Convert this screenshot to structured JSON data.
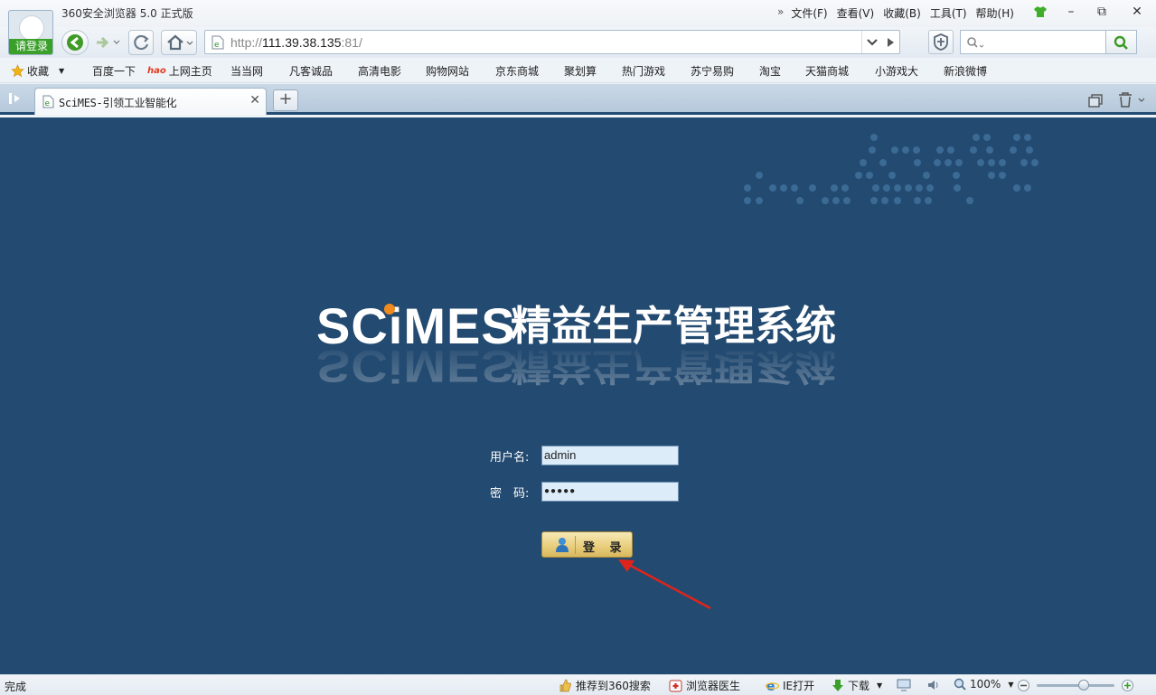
{
  "window": {
    "app_title": "360安全浏览器 5.0 正式版",
    "login_prompt": "请登录",
    "menus": [
      "文件(F)",
      "查看(V)",
      "收藏(B)",
      "工具(T)",
      "帮助(H)"
    ],
    "controls": {
      "minimize": "–",
      "restore": "⧉",
      "close": "✕"
    }
  },
  "address_bar": {
    "scheme": "http://",
    "host": "111.39.38.135",
    "port": ":81/"
  },
  "bookmarks": {
    "favorites_label": "收藏",
    "items": [
      "百度一下",
      "上网主页",
      "当当网",
      "凡客诚品",
      "高清电影",
      "购物网站",
      "京东商城",
      "聚划算",
      "热门游戏",
      "苏宁易购",
      "淘宝",
      "天猫商城",
      "小游戏大",
      "新浪微博"
    ]
  },
  "tabs": [
    {
      "title": "SciMES-引领工业智能化",
      "active": true
    }
  ],
  "page": {
    "logo_text": "SCiMES",
    "logo_subtitle": "精益生产管理系统",
    "username_label": "用户名:",
    "username_value": "admin",
    "password_label": "密　码:",
    "password_value": "●●●●●",
    "login_button": "登 录",
    "colors": {
      "background": "#234a70",
      "input_bg": "#dcecf9",
      "button_gold": "#e9cf7f",
      "arrow": "#e0241b"
    }
  },
  "status_bar": {
    "status": "完成",
    "recommend": "推荐到360搜索",
    "doctor": "浏览器医生",
    "ie_open": "IE打开",
    "download": "下载",
    "zoom": "100%",
    "zoom_level": 0.6
  }
}
